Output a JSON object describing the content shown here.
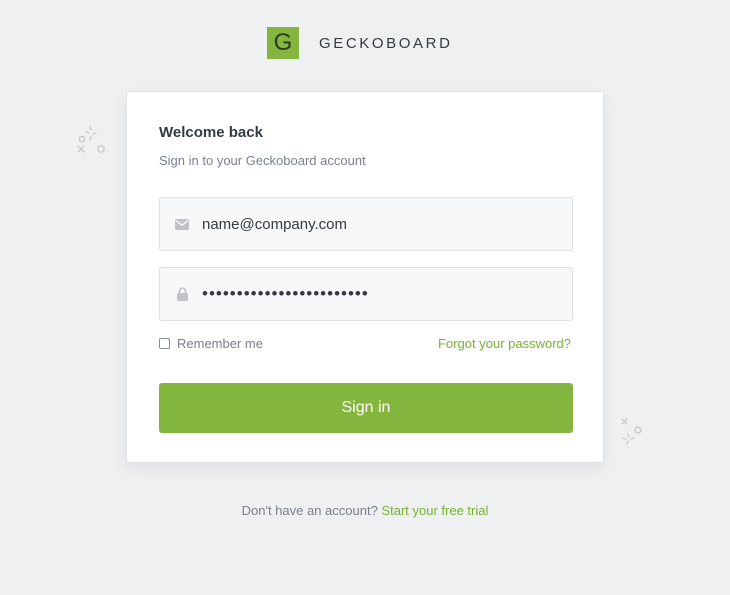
{
  "brand": {
    "mark": "G",
    "name": "GECKOBOARD"
  },
  "login": {
    "title": "Welcome back",
    "subtitle": "Sign in to your Geckoboard account",
    "email_value": "name@company.com",
    "password_value": "••••••••••••••••••••••••",
    "email_icon": "envelope-icon",
    "password_icon": "lock-icon",
    "remember_label": "Remember me",
    "remember_checked": false,
    "forgot_label": "Forgot your password?",
    "submit_label": "Sign in"
  },
  "footer": {
    "prompt": "Don't have an account?",
    "link_label": "Start your free trial"
  },
  "colors": {
    "accent": "#84b63f",
    "link": "#78b131",
    "background": "#eef0f2"
  }
}
